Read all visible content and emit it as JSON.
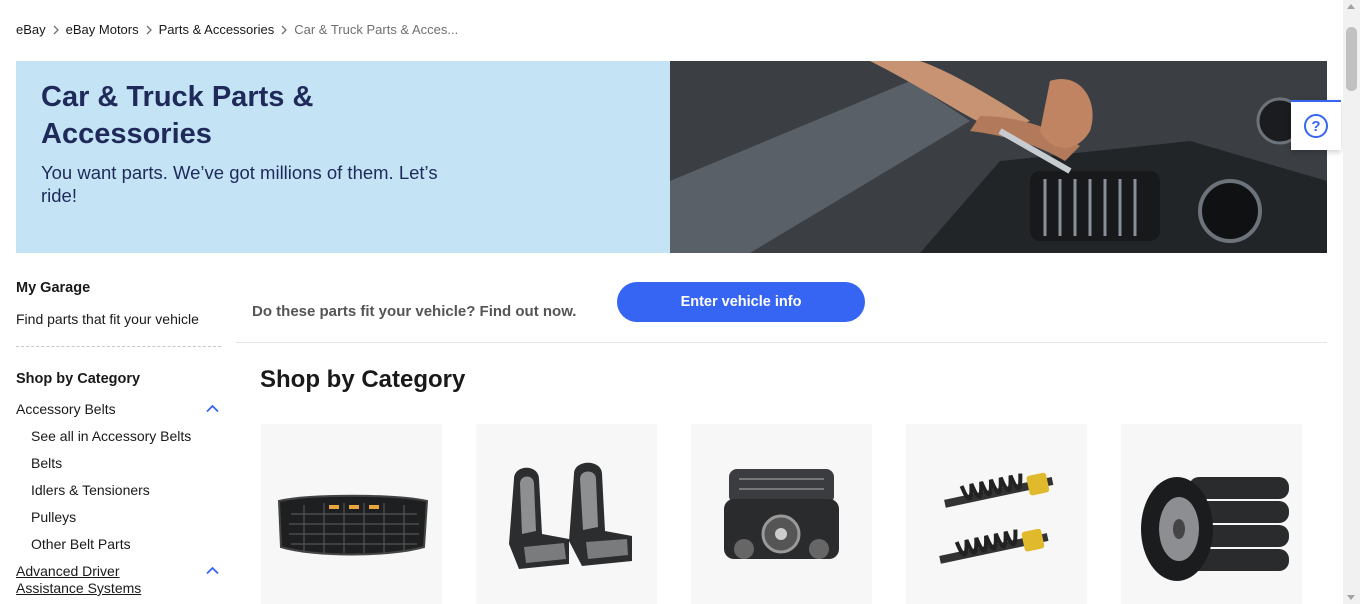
{
  "breadcrumb": [
    "eBay",
    "eBay Motors",
    "Parts & Accessories",
    "Car & Truck Parts & Acces..."
  ],
  "hero": {
    "title": "Car & Truck Parts & Accessories",
    "subtitle": "You want parts. We’ve got millions of them. Let’s ride!"
  },
  "help": {
    "icon": "question-icon",
    "glyph": "?"
  },
  "garage": {
    "heading": "My Garage",
    "text": "Find parts that fit your vehicle"
  },
  "sidebar": {
    "heading": "Shop by Category",
    "groups": [
      {
        "label": "Accessory Belts",
        "items": [
          "See all in Accessory Belts",
          "Belts",
          "Idlers & Tensioners",
          "Pulleys",
          "Other Belt Parts"
        ]
      },
      {
        "label": "Advanced Driver Assistance Systems",
        "items": []
      }
    ]
  },
  "fit": {
    "prompt": "Do these parts fit your vehicle? Find out now.",
    "button": "Enter vehicle info"
  },
  "main": {
    "category_heading": "Shop by Category",
    "tiles": [
      {
        "image": "grille-image"
      },
      {
        "image": "seat-covers-image"
      },
      {
        "image": "engine-image"
      },
      {
        "image": "struts-image"
      },
      {
        "image": "tires-image"
      }
    ]
  },
  "colors": {
    "accent": "#3665f3",
    "hero_bg": "#c4e4f6",
    "hero_text": "#1f2a5a"
  }
}
